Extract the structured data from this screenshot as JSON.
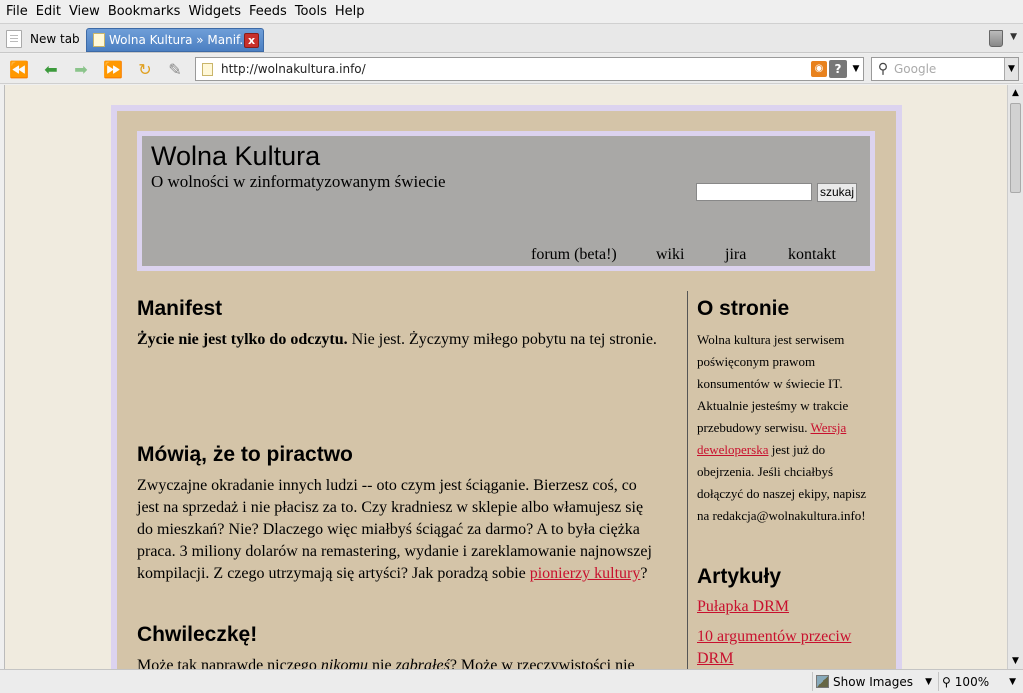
{
  "menu": {
    "items": [
      "File",
      "Edit",
      "View",
      "Bookmarks",
      "Widgets",
      "Feeds",
      "Tools",
      "Help"
    ]
  },
  "tabs": {
    "new_tab_label": "New tab",
    "active_title": "Wolna Kultura » Manif...",
    "close_symbol": "x"
  },
  "nav": {
    "url": "http://wolnakultura.info/",
    "search_placeholder": "Google",
    "help_symbol": "?"
  },
  "page": {
    "site_title": "Wolna Kultura",
    "site_subtitle": "O wolności w zinformatyzowanym świecie",
    "search_button": "szukaj",
    "nav_links": [
      "forum (beta!)",
      "wiki",
      "jira",
      "kontakt"
    ],
    "main": {
      "h_manifest": "Manifest",
      "manifest_bold": "Życie nie jest tylko do odczytu.",
      "manifest_rest": " Nie jest. Życzymy miłego pobytu na tej stronie.",
      "h_piractwo": "Mówią, że to piractwo",
      "piractwo_text": "Zwyczajne okradanie innych ludzi -- oto czym jest ściąganie. Bierzesz coś, co jest na sprzedaż i nie płacisz za to. Czy kradniesz w sklepie albo włamujesz się do mieszkań? Nie? Dlaczego więc miałbyś ściągać za darmo? A to była ciężka praca. 3 miliony dolarów na remastering, wydanie i zareklamowanie najnowszej kompilacji. Z czego utrzymają się artyści? Jak poradzą sobie ",
      "piractwo_link": "pionierzy kultury",
      "piractwo_end": "?",
      "h_chwileczke": "Chwileczkę!",
      "chw_1": "Może tak naprawdę niczego ",
      "chw_2": "nikomu",
      "chw_3": " nie ",
      "chw_4": "zabrałeś",
      "chw_5": "? Może w rzeczywistości nie"
    },
    "sidebar": {
      "h_ostronie": "O stronie",
      "ostronie_1": "Wolna kultura jest serwisem poświęconym prawom konsumentów w świecie IT. Aktualnie jesteśmy w trakcie przebudowy serwisu. ",
      "ostronie_link": "Wersja deweloperska",
      "ostronie_2": " jest już do obejrzenia. Jeśli chciałbyś dołączyć do naszej ekipy, napisz na redakcja@wolnakultura.info!",
      "h_artykuly": "Artykuły",
      "art_1": "Pułapka DRM",
      "art_2": "10 argumentów przeciw DRM"
    }
  },
  "status": {
    "show_images": "Show Images",
    "zoom": "100%"
  },
  "colors": {
    "page_bg": "#d4c4a8",
    "border_lavender": "#dcd3ef",
    "header_bg": "#a9a8a6",
    "link_red": "#c8102e",
    "tab_active_blue": "#4b7fc2"
  }
}
